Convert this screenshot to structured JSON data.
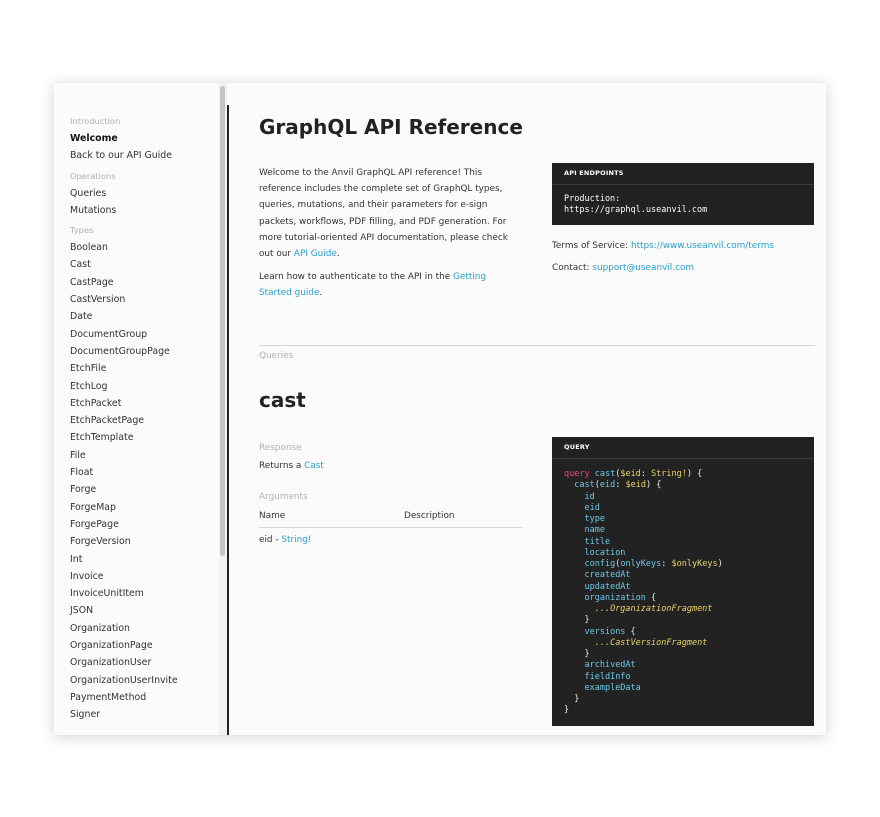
{
  "sidebar": {
    "sections": [
      {
        "title": "Introduction",
        "items": [
          {
            "label": "Welcome",
            "active": true
          },
          {
            "label": "Back to our API Guide"
          }
        ]
      },
      {
        "title": "Operations",
        "items": [
          {
            "label": "Queries"
          },
          {
            "label": "Mutations"
          }
        ]
      },
      {
        "title": "Types",
        "items": [
          {
            "label": "Boolean"
          },
          {
            "label": "Cast"
          },
          {
            "label": "CastPage"
          },
          {
            "label": "CastVersion"
          },
          {
            "label": "Date"
          },
          {
            "label": "DocumentGroup"
          },
          {
            "label": "DocumentGroupPage"
          },
          {
            "label": "EtchFile"
          },
          {
            "label": "EtchLog"
          },
          {
            "label": "EtchPacket"
          },
          {
            "label": "EtchPacketPage"
          },
          {
            "label": "EtchTemplate"
          },
          {
            "label": "File"
          },
          {
            "label": "Float"
          },
          {
            "label": "Forge"
          },
          {
            "label": "ForgeMap"
          },
          {
            "label": "ForgePage"
          },
          {
            "label": "ForgeVersion"
          },
          {
            "label": "Int"
          },
          {
            "label": "Invoice"
          },
          {
            "label": "InvoiceUnitItem"
          },
          {
            "label": "JSON"
          },
          {
            "label": "Organization"
          },
          {
            "label": "OrganizationPage"
          },
          {
            "label": "OrganizationUser"
          },
          {
            "label": "OrganizationUserInvite"
          },
          {
            "label": "PaymentMethod"
          },
          {
            "label": "Signer"
          }
        ]
      }
    ]
  },
  "main": {
    "title": "GraphQL API Reference",
    "intro": {
      "p1_text": "Welcome to the Anvil GraphQL API reference! This reference includes the complete set of GraphQL types, queries, mutations, and their parameters for e-sign packets, workflows, PDF filling, and PDF generation. For more tutorial-oriented API documentation, please check out our ",
      "p1_link": "API Guide",
      "p1_end": ".",
      "p2_text": "Learn how to authenticate to the API in the ",
      "p2_link": "Getting Started guide",
      "p2_end": "."
    },
    "endpoints": {
      "header": "API ENDPOINTS",
      "production_label": "Production:",
      "production_url": "https://graphql.useanvil.com"
    },
    "terms_label": "Terms of Service: ",
    "terms_url": "https://www.useanvil.com/terms",
    "contact_label": "Contact: ",
    "contact_email": "support@useanvil.com",
    "queries_label": "Queries",
    "cast": {
      "title": "cast",
      "response_label": "Response",
      "returns_text": "Returns a ",
      "returns_type": "Cast",
      "arguments_label": "Arguments",
      "col_name": "Name",
      "col_description": "Description",
      "arg_name": "eid",
      "arg_sep": " - ",
      "arg_type": "String!",
      "query_header": "QUERY"
    }
  },
  "colors": {
    "accent_link": "#2a9ecf",
    "code_bg": "#222222",
    "keyword": "#e64b72",
    "field": "#6ec9e6",
    "variable": "#e8d36b"
  }
}
